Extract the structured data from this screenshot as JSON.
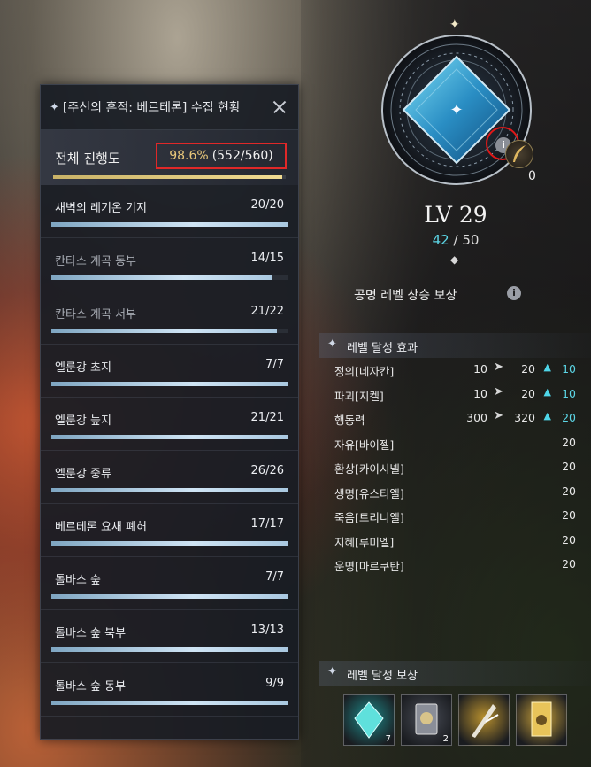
{
  "collection": {
    "title": "[주신의 흔적: 베르테론] 수집 현황",
    "overall": {
      "label": "전체 진행도",
      "percent": "98.6%",
      "count": "(552/560)",
      "progress": 0.986
    },
    "regions": [
      {
        "name": "새벽의 레기온 기지",
        "count": "20/20",
        "progress": 1.0,
        "dim": false
      },
      {
        "name": "칸타스 계곡 동부",
        "count": "14/15",
        "progress": 0.933,
        "dim": true
      },
      {
        "name": "칸타스 계곡 서부",
        "count": "21/22",
        "progress": 0.955,
        "dim": true
      },
      {
        "name": "엘룬강 초지",
        "count": "7/7",
        "progress": 1.0,
        "dim": false
      },
      {
        "name": "엘룬강 늪지",
        "count": "21/21",
        "progress": 1.0,
        "dim": false
      },
      {
        "name": "엘룬강 중류",
        "count": "26/26",
        "progress": 1.0,
        "dim": false
      },
      {
        "name": "베르테론 요새 폐허",
        "count": "17/17",
        "progress": 1.0,
        "dim": false
      },
      {
        "name": "톨바스 숲",
        "count": "7/7",
        "progress": 1.0,
        "dim": false
      },
      {
        "name": "톨바스 숲 북부",
        "count": "13/13",
        "progress": 1.0,
        "dim": false
      },
      {
        "name": "톨바스 숲 동부",
        "count": "9/9",
        "progress": 1.0,
        "dim": false
      }
    ]
  },
  "level": {
    "label": "LV 29",
    "current": "42",
    "separator": "/",
    "max": "50",
    "feather_count": "0",
    "info_icon": "i"
  },
  "resonance": {
    "title": "공명 레벨 상승 보상",
    "info_icon": "i"
  },
  "level_effects": {
    "heading": "레벨 달성 효과",
    "rows": [
      {
        "name": "정의[네자칸]",
        "before": "10",
        "after": "20",
        "value": "10",
        "highlight": true,
        "arrow": true
      },
      {
        "name": "파괴[지켈]",
        "before": "10",
        "after": "20",
        "value": "10",
        "highlight": true,
        "arrow": true
      },
      {
        "name": "행동력",
        "before": "300",
        "after": "320",
        "value": "20",
        "highlight": true,
        "arrow": true
      },
      {
        "name": "자유[바이젤]",
        "value": "20",
        "highlight": false,
        "arrow": false
      },
      {
        "name": "환상[카이시넬]",
        "value": "20",
        "highlight": false,
        "arrow": false
      },
      {
        "name": "생명[유스티엘]",
        "value": "20",
        "highlight": false,
        "arrow": false
      },
      {
        "name": "죽음[트리니엘]",
        "value": "20",
        "highlight": false,
        "arrow": false
      },
      {
        "name": "지혜[루미엘]",
        "value": "20",
        "highlight": false,
        "arrow": false
      },
      {
        "name": "운명[마르쿠탄]",
        "value": "20",
        "highlight": false,
        "arrow": false
      }
    ]
  },
  "level_rewards": {
    "heading": "레벨 달성 보상",
    "items": [
      {
        "icon": "teal-crystal-icon",
        "quantity": "7",
        "color": "#1e8a8a"
      },
      {
        "icon": "silver-card-icon",
        "quantity": "2",
        "color": "#4a4e58"
      },
      {
        "icon": "golden-weapon-icon",
        "quantity": "",
        "color": "#b8902e"
      },
      {
        "icon": "golden-scroll-icon",
        "quantity": "",
        "color": "#c8a03a"
      }
    ]
  },
  "colors": {
    "accent_cyan": "#5cd6e6",
    "progress_gold": "#e8c77a",
    "highlight_red": "#e02828"
  }
}
